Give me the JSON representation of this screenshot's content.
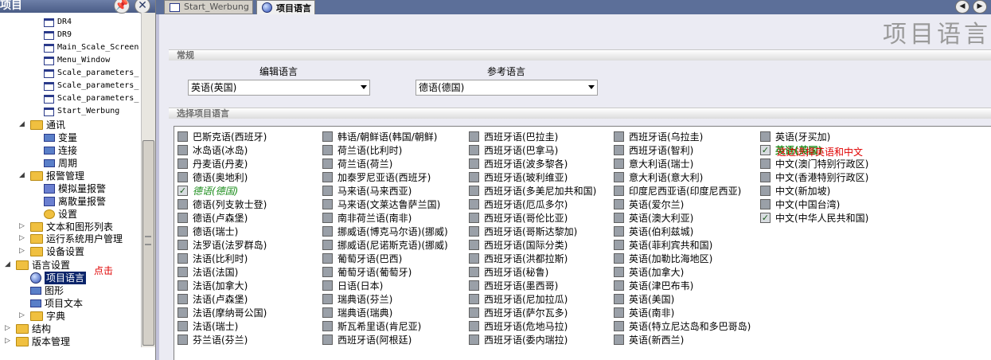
{
  "left_panel": {
    "title": "项目",
    "pin_glyph": "📌",
    "close_glyph": "✕",
    "tree": [
      {
        "label": "DR4",
        "icon": "doc-icon",
        "mono": true
      },
      {
        "label": "DR9",
        "icon": "doc-icon",
        "mono": true
      },
      {
        "label": "Main_Scale_Screen",
        "icon": "doc-icon",
        "mono": true
      },
      {
        "label": "Menu_Window",
        "icon": "doc-icon",
        "mono": true
      },
      {
        "label": "Scale_parameters_",
        "icon": "doc-icon",
        "mono": true
      },
      {
        "label": "Scale_parameters_",
        "icon": "doc-icon",
        "mono": true
      },
      {
        "label": "Scale_parameters_",
        "icon": "doc-icon",
        "mono": true
      },
      {
        "label": "Start_Werbung",
        "icon": "doc-icon",
        "mono": true
      },
      {
        "label": "通讯",
        "icon": "folder-icon"
      },
      {
        "label": "变量",
        "icon": "variable-icon"
      },
      {
        "label": "连接",
        "icon": "connection-icon"
      },
      {
        "label": "周期",
        "icon": "cycle-icon"
      },
      {
        "label": "报警管理",
        "icon": "folder-icon"
      },
      {
        "label": "模拟量报警",
        "icon": "analog-alarm-icon"
      },
      {
        "label": "离散量报警",
        "icon": "discrete-alarm-icon"
      },
      {
        "label": "设置",
        "icon": "settings-icon"
      },
      {
        "label": "文本和图形列表",
        "icon": "folder-icon"
      },
      {
        "label": "运行系统用户管理",
        "icon": "folder-icon"
      },
      {
        "label": "设备设置",
        "icon": "folder-icon"
      },
      {
        "label": "语言设置",
        "icon": "folder-icon"
      },
      {
        "label": "项目语言",
        "icon": "globe-icon"
      },
      {
        "label": "图形",
        "icon": "graphics-icon"
      },
      {
        "label": "项目文本",
        "icon": "text-icon"
      },
      {
        "label": "字典",
        "icon": "folder-icon"
      },
      {
        "label": "结构",
        "icon": "folder-icon"
      },
      {
        "label": "版本管理",
        "icon": "folder-icon"
      }
    ],
    "annotation_click": "点击"
  },
  "tabs": [
    {
      "label": "Start_Werbung",
      "active": false
    },
    {
      "label": "项目语言",
      "active": true
    }
  ],
  "nav": {
    "left": "◀",
    "right": "▶"
  },
  "editor": {
    "title": "项目语言",
    "section_general": "常规",
    "edit_language_label": "编辑语言",
    "edit_language_value": "英语(英国)",
    "reference_language_label": "参考语言",
    "reference_language_value": "德语(德国)",
    "section_select": "选择项目语言",
    "hint": "这边选择英语和中文",
    "columns": [
      [
        {
          "label": "巴斯克语(西班牙)",
          "checked": false
        },
        {
          "label": "冰岛语(冰岛)",
          "checked": false
        },
        {
          "label": "丹麦语(丹麦)",
          "checked": false
        },
        {
          "label": "德语(奥地利)",
          "checked": false
        },
        {
          "label": "德语(德国)",
          "checked": true,
          "style": "italic"
        },
        {
          "label": "德语(列支敦士登)",
          "checked": false
        },
        {
          "label": "德语(卢森堡)",
          "checked": false
        },
        {
          "label": "德语(瑞士)",
          "checked": false
        },
        {
          "label": "法罗语(法罗群岛)",
          "checked": false
        },
        {
          "label": "法语(比利时)",
          "checked": false
        },
        {
          "label": "法语(法国)",
          "checked": false
        },
        {
          "label": "法语(加拿大)",
          "checked": false
        },
        {
          "label": "法语(卢森堡)",
          "checked": false
        },
        {
          "label": "法语(摩纳哥公国)",
          "checked": false
        },
        {
          "label": "法语(瑞士)",
          "checked": false
        },
        {
          "label": "芬兰语(芬兰)",
          "checked": false
        }
      ],
      [
        {
          "label": "韩语/朝鲜语(韩国/朝鲜)",
          "checked": false
        },
        {
          "label": "荷兰语(比利时)",
          "checked": false
        },
        {
          "label": "荷兰语(荷兰)",
          "checked": false
        },
        {
          "label": "加泰罗尼亚语(西班牙)",
          "checked": false
        },
        {
          "label": "马来语(马来西亚)",
          "checked": false
        },
        {
          "label": "马来语(文莱达鲁萨兰国)",
          "checked": false
        },
        {
          "label": "南非荷兰语(南非)",
          "checked": false
        },
        {
          "label": "挪威语(博克马尔语)(挪威)",
          "checked": false
        },
        {
          "label": "挪威语(尼诺斯克语)(挪威)",
          "checked": false
        },
        {
          "label": "葡萄牙语(巴西)",
          "checked": false
        },
        {
          "label": "葡萄牙语(葡萄牙)",
          "checked": false
        },
        {
          "label": "日语(日本)",
          "checked": false
        },
        {
          "label": "瑞典语(芬兰)",
          "checked": false
        },
        {
          "label": "瑞典语(瑞典)",
          "checked": false
        },
        {
          "label": "斯瓦希里语(肯尼亚)",
          "checked": false
        },
        {
          "label": "西班牙语(阿根廷)",
          "checked": false
        }
      ],
      [
        {
          "label": "西班牙语(巴拉圭)",
          "checked": false
        },
        {
          "label": "西班牙语(巴拿马)",
          "checked": false
        },
        {
          "label": "西班牙语(波多黎各)",
          "checked": false
        },
        {
          "label": "西班牙语(玻利维亚)",
          "checked": false
        },
        {
          "label": "西班牙语(多美尼加共和国)",
          "checked": false
        },
        {
          "label": "西班牙语(厄瓜多尔)",
          "checked": false
        },
        {
          "label": "西班牙语(哥伦比亚)",
          "checked": false
        },
        {
          "label": "西班牙语(哥斯达黎加)",
          "checked": false
        },
        {
          "label": "西班牙语(国际分类)",
          "checked": false
        },
        {
          "label": "西班牙语(洪都拉斯)",
          "checked": false
        },
        {
          "label": "西班牙语(秘鲁)",
          "checked": false
        },
        {
          "label": "西班牙语(墨西哥)",
          "checked": false
        },
        {
          "label": "西班牙语(尼加拉瓜)",
          "checked": false
        },
        {
          "label": "西班牙语(萨尔瓦多)",
          "checked": false
        },
        {
          "label": "西班牙语(危地马拉)",
          "checked": false
        },
        {
          "label": "西班牙语(委内瑞拉)",
          "checked": false
        }
      ],
      [
        {
          "label": "西班牙语(乌拉圭)",
          "checked": false
        },
        {
          "label": "西班牙语(智利)",
          "checked": false
        },
        {
          "label": "意大利语(瑞士)",
          "checked": false
        },
        {
          "label": "意大利语(意大利)",
          "checked": false
        },
        {
          "label": "印度尼西亚语(印度尼西亚)",
          "checked": false
        },
        {
          "label": "英语(爱尔兰)",
          "checked": false
        },
        {
          "label": "英语(澳大利亚)",
          "checked": false
        },
        {
          "label": "英语(伯利兹城)",
          "checked": false
        },
        {
          "label": "英语(菲利宾共和国)",
          "checked": false
        },
        {
          "label": "英语(加勒比海地区)",
          "checked": false
        },
        {
          "label": "英语(加拿大)",
          "checked": false
        },
        {
          "label": "英语(津巴布韦)",
          "checked": false
        },
        {
          "label": "英语(美国)",
          "checked": false
        },
        {
          "label": "英语(南非)",
          "checked": false
        },
        {
          "label": "英语(特立尼达岛和多巴哥岛)",
          "checked": false
        },
        {
          "label": "英语(新西兰)",
          "checked": false
        }
      ],
      [
        {
          "label": "英语(牙买加)",
          "checked": false
        },
        {
          "label": "英语(英国)",
          "checked": true,
          "style": "bold"
        },
        {
          "label": "中文(澳门特别行政区)",
          "checked": false
        },
        {
          "label": "中文(香港特别行政区)",
          "checked": false
        },
        {
          "label": "中文(新加坡)",
          "checked": false
        },
        {
          "label": "中文(中国台湾)",
          "checked": false
        },
        {
          "label": "中文(中华人民共和国)",
          "checked": true
        }
      ]
    ]
  },
  "colors": {
    "accent": "#0a246a",
    "header_bg": "#5c6f99",
    "hint_red": "#e00000",
    "checked_green": "#1f8f1f"
  }
}
